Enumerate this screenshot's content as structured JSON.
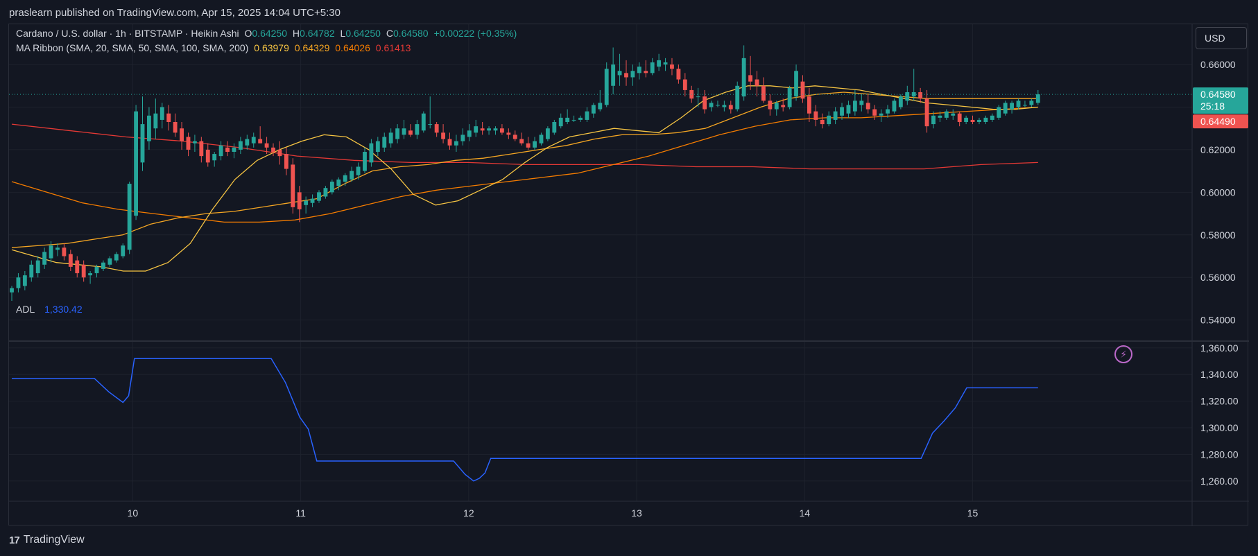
{
  "header": {
    "published": "praslearn published on TradingView.com, Apr 15, 2025 14:04 UTC+5:30"
  },
  "legend": {
    "symbol": "Cardano / U.S. dollar · 1h · BITSTAMP · Heikin Ashi",
    "o_label": "O",
    "o_value": "0.64250",
    "h_label": "H",
    "h_value": "0.64782",
    "l_label": "L",
    "l_value": "0.64250",
    "c_label": "C",
    "c_value": "0.64580",
    "change": "+0.00222 (+0.35%)",
    "ma_name": "MA Ribbon (SMA, 20, SMA, 50, SMA, 100, SMA, 200)",
    "ma_values": [
      "0.63979",
      "0.64329",
      "0.64026",
      "0.61413"
    ],
    "adl_name": "ADL",
    "adl_value": "1,330.42"
  },
  "buttons": {
    "currency": "USD"
  },
  "price_tags": {
    "last": "0.64580",
    "countdown": "25:18",
    "sma200_tag": "0.64490"
  },
  "footer": {
    "brand": "TradingView",
    "logo": "17"
  },
  "colors": {
    "up": "#26a69a",
    "down": "#ef5350",
    "sma20": "#f7c543",
    "sma50": "#f5a623",
    "sma100": "#f57c00",
    "sma200": "#e53935",
    "adl": "#2962ff"
  },
  "chart_data": [
    {
      "type": "candlestick",
      "ylim": [
        0.535,
        0.675
      ],
      "y_ticks": [
        "0.66000",
        "0.64000",
        "0.62000",
        "0.60000",
        "0.58000",
        "0.56000",
        "0.54000"
      ],
      "x_ticks": [
        "10",
        "11",
        "12",
        "13",
        "14",
        "15"
      ],
      "ohlc": [
        [
          0.553,
          0.556,
          0.549,
          0.555
        ],
        [
          0.555,
          0.562,
          0.553,
          0.56
        ],
        [
          0.556,
          0.563,
          0.554,
          0.561
        ],
        [
          0.56,
          0.568,
          0.558,
          0.566
        ],
        [
          0.562,
          0.57,
          0.56,
          0.568
        ],
        [
          0.566,
          0.574,
          0.564,
          0.572
        ],
        [
          0.569,
          0.577,
          0.567,
          0.575
        ],
        [
          0.573,
          0.576,
          0.57,
          0.574
        ],
        [
          0.574,
          0.576,
          0.568,
          0.57
        ],
        [
          0.571,
          0.573,
          0.563,
          0.565
        ],
        [
          0.568,
          0.57,
          0.56,
          0.562
        ],
        [
          0.566,
          0.568,
          0.558,
          0.56
        ],
        [
          0.561,
          0.563,
          0.557,
          0.562
        ],
        [
          0.562,
          0.566,
          0.56,
          0.565
        ],
        [
          0.564,
          0.568,
          0.563,
          0.567
        ],
        [
          0.566,
          0.57,
          0.565,
          0.569
        ],
        [
          0.568,
          0.572,
          0.567,
          0.571
        ],
        [
          0.57,
          0.576,
          0.569,
          0.575
        ],
        [
          0.573,
          0.605,
          0.571,
          0.604
        ],
        [
          0.589,
          0.641,
          0.587,
          0.638
        ],
        [
          0.614,
          0.645,
          0.61,
          0.632
        ],
        [
          0.624,
          0.64,
          0.62,
          0.636
        ],
        [
          0.63,
          0.644,
          0.625,
          0.637
        ],
        [
          0.634,
          0.642,
          0.63,
          0.64
        ],
        [
          0.637,
          0.641,
          0.629,
          0.633
        ],
        [
          0.633,
          0.637,
          0.626,
          0.628
        ],
        [
          0.63,
          0.633,
          0.62,
          0.624
        ],
        [
          0.626,
          0.628,
          0.617,
          0.62
        ],
        [
          0.623,
          0.627,
          0.619,
          0.624
        ],
        [
          0.624,
          0.626,
          0.614,
          0.617
        ],
        [
          0.62,
          0.623,
          0.612,
          0.614
        ],
        [
          0.615,
          0.619,
          0.612,
          0.618
        ],
        [
          0.617,
          0.624,
          0.615,
          0.622
        ],
        [
          0.621,
          0.624,
          0.617,
          0.619
        ],
        [
          0.619,
          0.623,
          0.616,
          0.621
        ],
        [
          0.62,
          0.626,
          0.618,
          0.624
        ],
        [
          0.622,
          0.627,
          0.62,
          0.625
        ],
        [
          0.623,
          0.628,
          0.621,
          0.626
        ],
        [
          0.625,
          0.631,
          0.623,
          0.623
        ],
        [
          0.623,
          0.626,
          0.618,
          0.621
        ],
        [
          0.621,
          0.623,
          0.617,
          0.619
        ],
        [
          0.62,
          0.624,
          0.613,
          0.617
        ],
        [
          0.618,
          0.621,
          0.608,
          0.611
        ],
        [
          0.613,
          0.616,
          0.59,
          0.593
        ],
        [
          0.6,
          0.603,
          0.586,
          0.592
        ],
        [
          0.594,
          0.598,
          0.59,
          0.596
        ],
        [
          0.595,
          0.599,
          0.593,
          0.597
        ],
        [
          0.596,
          0.601,
          0.595,
          0.6
        ],
        [
          0.598,
          0.603,
          0.597,
          0.602
        ],
        [
          0.6,
          0.606,
          0.599,
          0.605
        ],
        [
          0.603,
          0.607,
          0.601,
          0.606
        ],
        [
          0.605,
          0.609,
          0.603,
          0.608
        ],
        [
          0.606,
          0.612,
          0.605,
          0.61
        ],
        [
          0.608,
          0.614,
          0.606,
          0.612
        ],
        [
          0.61,
          0.621,
          0.609,
          0.619
        ],
        [
          0.614,
          0.625,
          0.612,
          0.623
        ],
        [
          0.619,
          0.626,
          0.617,
          0.624
        ],
        [
          0.621,
          0.628,
          0.619,
          0.626
        ],
        [
          0.623,
          0.63,
          0.621,
          0.628
        ],
        [
          0.625,
          0.632,
          0.623,
          0.63
        ],
        [
          0.627,
          0.634,
          0.625,
          0.63
        ],
        [
          0.629,
          0.632,
          0.626,
          0.627
        ],
        [
          0.627,
          0.634,
          0.625,
          0.632
        ],
        [
          0.629,
          0.638,
          0.628,
          0.637
        ],
        [
          0.632,
          0.645,
          0.63,
          0.632
        ],
        [
          0.632,
          0.633,
          0.626,
          0.628
        ],
        [
          0.628,
          0.632,
          0.623,
          0.625
        ],
        [
          0.625,
          0.628,
          0.62,
          0.622
        ],
        [
          0.622,
          0.627,
          0.619,
          0.624
        ],
        [
          0.624,
          0.63,
          0.622,
          0.627
        ],
        [
          0.626,
          0.632,
          0.624,
          0.629
        ],
        [
          0.628,
          0.634,
          0.626,
          0.631
        ],
        [
          0.63,
          0.633,
          0.627,
          0.629
        ],
        [
          0.629,
          0.631,
          0.627,
          0.63
        ],
        [
          0.629,
          0.631,
          0.627,
          0.63
        ],
        [
          0.63,
          0.632,
          0.627,
          0.628
        ],
        [
          0.628,
          0.63,
          0.625,
          0.627
        ],
        [
          0.627,
          0.629,
          0.624,
          0.625
        ],
        [
          0.625,
          0.628,
          0.622,
          0.623
        ],
        [
          0.623,
          0.626,
          0.62,
          0.621
        ],
        [
          0.621,
          0.626,
          0.62,
          0.624
        ],
        [
          0.623,
          0.628,
          0.622,
          0.627
        ],
        [
          0.625,
          0.631,
          0.624,
          0.63
        ],
        [
          0.628,
          0.634,
          0.627,
          0.633
        ],
        [
          0.631,
          0.637,
          0.63,
          0.635
        ],
        [
          0.633,
          0.639,
          0.632,
          0.635
        ],
        [
          0.634,
          0.636,
          0.633,
          0.634
        ],
        [
          0.634,
          0.636,
          0.633,
          0.635
        ],
        [
          0.634,
          0.64,
          0.633,
          0.638
        ],
        [
          0.637,
          0.642,
          0.635,
          0.641
        ],
        [
          0.639,
          0.648,
          0.638,
          0.642
        ],
        [
          0.641,
          0.661,
          0.64,
          0.658
        ],
        [
          0.65,
          0.668,
          0.646,
          0.66
        ],
        [
          0.655,
          0.665,
          0.65,
          0.657
        ],
        [
          0.656,
          0.662,
          0.65,
          0.654
        ],
        [
          0.654,
          0.66,
          0.65,
          0.657
        ],
        [
          0.656,
          0.661,
          0.653,
          0.659
        ],
        [
          0.657,
          0.662,
          0.654,
          0.656
        ],
        [
          0.656,
          0.663,
          0.655,
          0.661
        ],
        [
          0.659,
          0.665,
          0.657,
          0.662
        ],
        [
          0.66,
          0.663,
          0.657,
          0.661
        ],
        [
          0.66,
          0.663,
          0.655,
          0.658
        ],
        [
          0.658,
          0.66,
          0.651,
          0.653
        ],
        [
          0.653,
          0.656,
          0.645,
          0.648
        ],
        [
          0.648,
          0.65,
          0.642,
          0.644
        ],
        [
          0.645,
          0.649,
          0.64,
          0.645
        ],
        [
          0.645,
          0.648,
          0.637,
          0.639
        ],
        [
          0.64,
          0.643,
          0.638,
          0.642
        ],
        [
          0.641,
          0.643,
          0.64,
          0.641
        ],
        [
          0.64,
          0.643,
          0.638,
          0.641
        ],
        [
          0.641,
          0.643,
          0.637,
          0.639
        ],
        [
          0.639,
          0.652,
          0.638,
          0.65
        ],
        [
          0.645,
          0.669,
          0.643,
          0.663
        ],
        [
          0.655,
          0.664,
          0.648,
          0.652
        ],
        [
          0.653,
          0.657,
          0.645,
          0.65
        ],
        [
          0.65,
          0.654,
          0.642,
          0.643
        ],
        [
          0.643,
          0.646,
          0.636,
          0.639
        ],
        [
          0.639,
          0.643,
          0.636,
          0.642
        ],
        [
          0.641,
          0.644,
          0.638,
          0.64
        ],
        [
          0.64,
          0.65,
          0.639,
          0.649
        ],
        [
          0.645,
          0.66,
          0.643,
          0.657
        ],
        [
          0.652,
          0.655,
          0.642,
          0.644
        ],
        [
          0.645,
          0.649,
          0.633,
          0.637
        ],
        [
          0.638,
          0.641,
          0.631,
          0.634
        ],
        [
          0.634,
          0.637,
          0.63,
          0.632
        ],
        [
          0.632,
          0.638,
          0.631,
          0.636
        ],
        [
          0.634,
          0.64,
          0.632,
          0.638
        ],
        [
          0.636,
          0.642,
          0.634,
          0.64
        ],
        [
          0.637,
          0.643,
          0.635,
          0.641
        ],
        [
          0.638,
          0.648,
          0.636,
          0.643
        ],
        [
          0.641,
          0.646,
          0.638,
          0.643
        ],
        [
          0.642,
          0.646,
          0.637,
          0.639
        ],
        [
          0.639,
          0.641,
          0.634,
          0.636
        ],
        [
          0.636,
          0.639,
          0.633,
          0.637
        ],
        [
          0.637,
          0.641,
          0.635,
          0.639
        ],
        [
          0.638,
          0.644,
          0.637,
          0.643
        ],
        [
          0.64,
          0.646,
          0.639,
          0.645
        ],
        [
          0.643,
          0.65,
          0.641,
          0.647
        ],
        [
          0.645,
          0.658,
          0.643,
          0.647
        ],
        [
          0.647,
          0.649,
          0.642,
          0.644
        ],
        [
          0.644,
          0.648,
          0.628,
          0.631
        ],
        [
          0.632,
          0.638,
          0.63,
          0.636
        ],
        [
          0.635,
          0.638,
          0.633,
          0.636
        ],
        [
          0.635,
          0.639,
          0.634,
          0.638
        ],
        [
          0.636,
          0.639,
          0.634,
          0.637
        ],
        [
          0.637,
          0.638,
          0.631,
          0.633
        ],
        [
          0.633,
          0.636,
          0.632,
          0.635
        ],
        [
          0.634,
          0.636,
          0.632,
          0.633
        ],
        [
          0.633,
          0.635,
          0.632,
          0.634
        ],
        [
          0.633,
          0.636,
          0.632,
          0.635
        ],
        [
          0.634,
          0.637,
          0.633,
          0.636
        ],
        [
          0.635,
          0.641,
          0.634,
          0.64
        ],
        [
          0.637,
          0.643,
          0.636,
          0.642
        ],
        [
          0.639,
          0.643,
          0.637,
          0.642
        ],
        [
          0.64,
          0.644,
          0.639,
          0.643
        ],
        [
          0.641,
          0.643,
          0.64,
          0.641
        ],
        [
          0.641,
          0.644,
          0.64,
          0.643
        ],
        [
          0.642,
          0.648,
          0.641,
          0.646
        ]
      ],
      "sma20": [
        0.573,
        0.57,
        0.567,
        0.566,
        0.565,
        0.563,
        0.563,
        0.567,
        0.576,
        0.592,
        0.606,
        0.615,
        0.62,
        0.624,
        0.627,
        0.626,
        0.62,
        0.611,
        0.599,
        0.594,
        0.596,
        0.601,
        0.606,
        0.614,
        0.621,
        0.626,
        0.628,
        0.63,
        0.629,
        0.628,
        0.635,
        0.643,
        0.647,
        0.65,
        0.65,
        0.649,
        0.65,
        0.649,
        0.648,
        0.646,
        0.644,
        0.642,
        0.641,
        0.64,
        0.639,
        0.639,
        0.64
      ],
      "sma50": [
        0.574,
        0.575,
        0.576,
        0.578,
        0.58,
        0.585,
        0.588,
        0.59,
        0.591,
        0.593,
        0.595,
        0.597,
        0.604,
        0.61,
        0.612,
        0.613,
        0.615,
        0.616,
        0.618,
        0.62,
        0.622,
        0.625,
        0.627,
        0.627,
        0.628,
        0.63,
        0.635,
        0.64,
        0.644,
        0.646,
        0.647,
        0.646,
        0.645,
        0.644,
        0.644,
        0.644,
        0.644,
        0.644
      ],
      "sma100": [
        0.605,
        0.6,
        0.595,
        0.592,
        0.59,
        0.588,
        0.586,
        0.586,
        0.587,
        0.59,
        0.594,
        0.598,
        0.601,
        0.603,
        0.605,
        0.607,
        0.609,
        0.613,
        0.617,
        0.622,
        0.627,
        0.631,
        0.634,
        0.635,
        0.635,
        0.636,
        0.637,
        0.638,
        0.639,
        0.64
      ],
      "sma200": [
        0.632,
        0.629,
        0.626,
        0.624,
        0.621,
        0.617,
        0.615,
        0.614,
        0.614,
        0.613,
        0.613,
        0.613,
        0.612,
        0.612,
        0.611,
        0.611,
        0.611,
        0.613,
        0.614
      ]
    },
    {
      "type": "line",
      "name": "ADL",
      "ylim": [
        1250,
        1362
      ],
      "y_ticks": [
        "1,360.00",
        "1,340.00",
        "1,320.00",
        "1,300.00",
        "1,280.00",
        "1,260.00"
      ],
      "x": [
        0,
        14.5,
        17,
        19.5,
        20.5,
        21.5,
        45.5,
        48,
        50.5,
        52,
        53.5,
        54.5,
        77.5,
        79.5,
        81,
        82,
        83,
        84,
        86,
        159.5,
        161.5,
        163.5,
        165.5,
        167.5,
        180
      ],
      "values": [
        1337,
        1337,
        1327,
        1319,
        1324,
        1352,
        1352,
        1334,
        1308,
        1299,
        1275,
        1275,
        1275,
        1265,
        1260,
        1262,
        1266,
        1277,
        1277,
        1277,
        1296,
        1305,
        1315,
        1330,
        1330
      ]
    }
  ]
}
